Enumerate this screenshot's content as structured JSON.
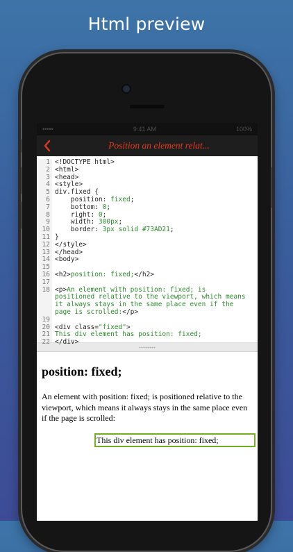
{
  "banner": {
    "title": "Html preview"
  },
  "status_bar": {
    "carrier": "••••• ",
    "time": "9:41 AM",
    "battery": "100%"
  },
  "nav": {
    "title": "Position an element relat..."
  },
  "editor": {
    "line_numbers": [
      "1",
      "2",
      "3",
      "4",
      "5",
      "6",
      "7",
      "8",
      "9",
      "10",
      "11",
      "12",
      "13",
      "14",
      "15",
      "16",
      "17",
      "18",
      "19",
      "20",
      "21",
      "22"
    ],
    "lines": [
      [
        {
          "t": "<!DOCTYPE html>",
          "c": "tag"
        }
      ],
      [
        {
          "t": "<html>",
          "c": "tag"
        }
      ],
      [
        {
          "t": "<head>",
          "c": "tag"
        }
      ],
      [
        {
          "t": "<style>",
          "c": "tag"
        }
      ],
      [
        {
          "t": "div.fixed {",
          "c": "tag"
        }
      ],
      [
        {
          "t": "    position: ",
          "c": "tag"
        },
        {
          "t": "fixed",
          "c": "val"
        },
        {
          "t": ";",
          "c": "tag"
        }
      ],
      [
        {
          "t": "    bottom: ",
          "c": "tag"
        },
        {
          "t": "0",
          "c": "val"
        },
        {
          "t": ";",
          "c": "tag"
        }
      ],
      [
        {
          "t": "    right: ",
          "c": "tag"
        },
        {
          "t": "0",
          "c": "val"
        },
        {
          "t": ";",
          "c": "tag"
        }
      ],
      [
        {
          "t": "    width: ",
          "c": "tag"
        },
        {
          "t": "300px",
          "c": "val"
        },
        {
          "t": ";",
          "c": "tag"
        }
      ],
      [
        {
          "t": "    border: ",
          "c": "tag"
        },
        {
          "t": "3px solid #73AD21",
          "c": "val"
        },
        {
          "t": ";",
          "c": "tag"
        }
      ],
      [
        {
          "t": "}",
          "c": "tag"
        }
      ],
      [
        {
          "t": "</style>",
          "c": "tag"
        }
      ],
      [
        {
          "t": "</head>",
          "c": "tag"
        }
      ],
      [
        {
          "t": "<body>",
          "c": "tag"
        }
      ],
      [
        {
          "t": "",
          "c": "tag"
        }
      ],
      [
        {
          "t": "<h2>",
          "c": "tag"
        },
        {
          "t": "position: fixed;",
          "c": "txt"
        },
        {
          "t": "</h2>",
          "c": "tag"
        }
      ],
      [
        {
          "t": "",
          "c": "tag"
        }
      ],
      [
        {
          "t": "<p>",
          "c": "tag"
        },
        {
          "t": "An element with position: fixed; is",
          "c": "txt"
        }
      ],
      [
        {
          "t": "positioned relative to the viewport, which means",
          "c": "txt"
        }
      ],
      [
        {
          "t": "it always stays in the same place even if the",
          "c": "txt"
        }
      ],
      [
        {
          "t": "page is scrolled:",
          "c": "txt"
        },
        {
          "t": "</p>",
          "c": "tag"
        }
      ],
      [
        {
          "t": "",
          "c": "tag"
        }
      ],
      [
        {
          "t": "<div class=",
          "c": "tag"
        },
        {
          "t": "\"fixed\"",
          "c": "val"
        },
        {
          "t": ">",
          "c": "tag"
        }
      ],
      [
        {
          "t": "This div element has position: fixed;",
          "c": "txt"
        }
      ],
      [
        {
          "t": "</div>",
          "c": "tag"
        }
      ]
    ]
  },
  "preview": {
    "heading": "position: fixed;",
    "paragraph": "An element with position: fixed; is positioned relative to the viewport, which means it always stays in the same place even if the page is scrolled:",
    "fixed_div_text": "This div element has position: fixed;"
  },
  "colors": {
    "accent": "#e33b1f",
    "fixed_border": "#73AD21",
    "code_green": "#2a8a2a"
  }
}
